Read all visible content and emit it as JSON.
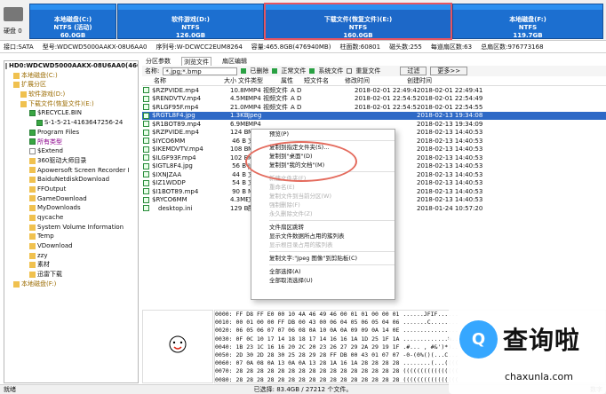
{
  "disk_label": "硬盘 0",
  "partitions": [
    {
      "name": "本地磁盘(C:)",
      "fs": "NTFS (活动)",
      "size": "60.0GB"
    },
    {
      "name": "软件游戏(D:)",
      "fs": "NTFS",
      "size": "126.0GB"
    },
    {
      "name": "下载文件(恢复文件)(E:)",
      "fs": "NTFS",
      "size": "160.0GB",
      "selected": true
    },
    {
      "name": "本地磁盘(F:)",
      "fs": "NTFS",
      "size": "119.7GB"
    }
  ],
  "info_items": [
    "接口:SATA",
    "型号:WDCWD5000AAKX-08U6AA0",
    "序列号:W-DCWCC2EUM8264",
    "容量:465.8GB(476940MB)",
    "柱面数:60801",
    "磁头数:255",
    "每道扇区数:63",
    "总扇区数:976773168"
  ],
  "tree": [
    "HD0:WDCWD5000AAKX-08U6AA0(466GB)",
    "本地磁盘(C:)",
    "扩展分区",
    "软件游戏(D:)",
    "下载文件(恢复文件)(E:)",
    "$RECYCLE.BIN",
    "S-1-5-21-4163647256-24",
    "Program Files",
    "所有类型",
    "$Extend",
    "360驱动大师目录",
    "Apowersoft Screen Recorder I",
    "BaiduNetdiskDownload",
    "FFOutput",
    "GameDownload",
    "MyDownloads",
    "qycache",
    "System Volume Information",
    "Temp",
    "VDownload",
    "zzy",
    "素材",
    "迅雷下载",
    "本地磁盘(F:)"
  ],
  "tabs": [
    "分区参数",
    "浏览文件",
    "扇区编辑"
  ],
  "filter": {
    "name_label": "名称:",
    "name_value": "*.jpg;*.bmp",
    "checks": [
      "已删除",
      "正常文件",
      "系统文件",
      "重复文件"
    ],
    "filter_button": "过滤",
    "more_button": "更多>>"
  },
  "columns": [
    "名称",
    "大小",
    "文件类型",
    "属性",
    "短文件名",
    "修改时间",
    "创建时间"
  ],
  "files": [
    {
      "name": "$RZPVIDE.mp4",
      "size": "10.8MB",
      "type": "MP4 视频文件",
      "attr": "A D",
      "short": "",
      "mtime": "2018-02-01 22:49:43",
      "ctime": "2018-02-01 22:49:41"
    },
    {
      "name": "$RENDVTV.mp4",
      "size": "4.5MB",
      "type": "MP4 视频文件",
      "attr": "A D",
      "short": "",
      "mtime": "2018-02-01 22:54:55",
      "ctime": "2018-02-01 22:54:49"
    },
    {
      "name": "$RLGF95F.mp4",
      "size": "21.0MB",
      "type": "MP4 视频文件",
      "attr": "A D",
      "short": "",
      "mtime": "2018-02-01 22:54:50",
      "ctime": "2018-02-01 22:54:55"
    },
    {
      "name": "$RGTL8F4.jpg",
      "size": "1.3KB",
      "type": "Jpeg",
      "attr": "",
      "short": "",
      "mtime": "",
      "ctime": "2018-02-13 19:34:08",
      "selected": true
    },
    {
      "name": "$R1BOT89.mp4",
      "size": "6.9MB",
      "type": "MP4",
      "attr": "",
      "short": "",
      "mtime": "",
      "ctime": "2018-02-13 19:34:09"
    },
    {
      "name": "$RZPVIDE.mp4",
      "size": "124 B",
      "type": "MP4",
      "attr": "",
      "short": "",
      "mtime": "",
      "ctime": "2018-02-13 14:40:53"
    },
    {
      "name": "$IYCO6MM",
      "size": "46 B",
      "type": "文件",
      "attr": "",
      "short": "",
      "mtime": "",
      "ctime": "2018-02-13 14:40:53"
    },
    {
      "name": "$IKEMDVTV.mp4",
      "size": "108 B",
      "type": "MP4",
      "attr": "",
      "short": "",
      "mtime": "",
      "ctime": "2018-02-13 14:40:53"
    },
    {
      "name": "$ILGF93F.mp4",
      "size": "102 B",
      "type": "MP4",
      "attr": "",
      "short": "",
      "mtime": "",
      "ctime": "2018-02-13 14:40:53"
    },
    {
      "name": "$IGTL8F4.jpg",
      "size": "56 B",
      "type": "Jpeg",
      "attr": "",
      "short": "",
      "mtime": "",
      "ctime": "2018-02-13 14:40:53"
    },
    {
      "name": "$IXNJZAA",
      "size": "44 B",
      "type": "文件",
      "attr": "",
      "short": "",
      "mtime": "",
      "ctime": "2018-02-13 14:40:53"
    },
    {
      "name": "$IZ1WDDP",
      "size": "54 B",
      "type": "文件",
      "attr": "",
      "short": "",
      "mtime": "",
      "ctime": "2018-02-13 14:40:53"
    },
    {
      "name": "$I1BOT89.mp4",
      "size": "90 B",
      "type": "MP4",
      "attr": "",
      "short": "",
      "mtime": "",
      "ctime": "2018-02-13 14:40:53"
    },
    {
      "name": "$RYCO6MM",
      "size": "4.3MB",
      "type": "文件",
      "attr": "",
      "short": "",
      "mtime": "",
      "ctime": "2018-02-13 14:40:53"
    },
    {
      "name": "desktop.ini",
      "size": "129 B",
      "type": "配置",
      "attr": "",
      "short": "",
      "mtime": "",
      "ctime": "2018-01-24 10:57:20"
    }
  ],
  "context_menu": [
    {
      "label": "预览(P)",
      "enabled": true
    },
    {
      "label": "",
      "sep": true
    },
    {
      "label": "复制到指定文件夹(S)...",
      "enabled": true
    },
    {
      "label": "复制到\"桌面\"(D)",
      "enabled": true
    },
    {
      "label": "复制到\"我的文档\"(M)",
      "enabled": true
    },
    {
      "label": "",
      "sep": true
    },
    {
      "label": "新建文件夹(F)",
      "enabled": false
    },
    {
      "label": "重命名(E)",
      "enabled": false
    },
    {
      "label": "复制文件到当前分区(W)",
      "enabled": false
    },
    {
      "label": "强制删除(F)",
      "enabled": false
    },
    {
      "label": "永久删除文件(Z)",
      "enabled": false
    },
    {
      "label": "",
      "sep": true
    },
    {
      "label": "文件扇区跳转",
      "enabled": true,
      "arrow": true
    },
    {
      "label": "显示文件数据所占用的簇列表",
      "enabled": true
    },
    {
      "label": "显示根目录占用的簇列表",
      "enabled": false
    },
    {
      "label": "",
      "sep": true
    },
    {
      "label": "复制文字:\"Jpeg 图像\"到剪贴板(C)",
      "enabled": true
    },
    {
      "label": "",
      "sep": true
    },
    {
      "label": "全部选择(A)",
      "enabled": true
    },
    {
      "label": "全部取消选择(U)",
      "enabled": true
    }
  ],
  "hex_lines": [
    "0000:  FF D8 FF E0 00 10 4A 46 49 46 00 01 01 00 00 01   ......JFIF......",
    "0010:  00 01 00 00 FF DB 00 43 00 06 04 05 06 05 04 06   .......C........",
    "0020:  06 05 06 07 07 06 08 0A 10 0A 0A 09 09 0A 14 0E   ................",
    "0030:  0F 0C 10 17 14 18 18 17 14 16 16 1A 1D 25 1F 1A   .............%..",
    "0040:  1B 23 1C 16 16 20 2C 20 23 26 27 29 2A 29 19 1F   .#... , #&')*)..",
    "0050:  2D 30 2D 28 30 25 28 29 28 FF DB 00 43 01 07 07   -0-(0%()(...C...",
    "0060:  07 0A 08 0A 13 0A 0A 13 28 1A 16 1A 28 28 28 28   ........(...((((",
    "0070:  28 28 28 28 28 28 28 28 28 28 28 28 28 28 28 28   ((((((((((((((((",
    "0080:  28 28 28 28 28 28 28 28 28 28 28 28 28 28 28 28   ((((((((((((((((",
    "0090:  28 28 28 28 28 28 28 28 28 28 28 28 28 28 28 28   (((((((((((((((("
  ],
  "status": {
    "left": "就绪",
    "right": "已选择: 83.4GB / 27212 个文件。",
    "right2": "数字"
  },
  "watermark": {
    "logo_text": "Q",
    "brand": "查询啦",
    "url": "chaxunla.com"
  }
}
